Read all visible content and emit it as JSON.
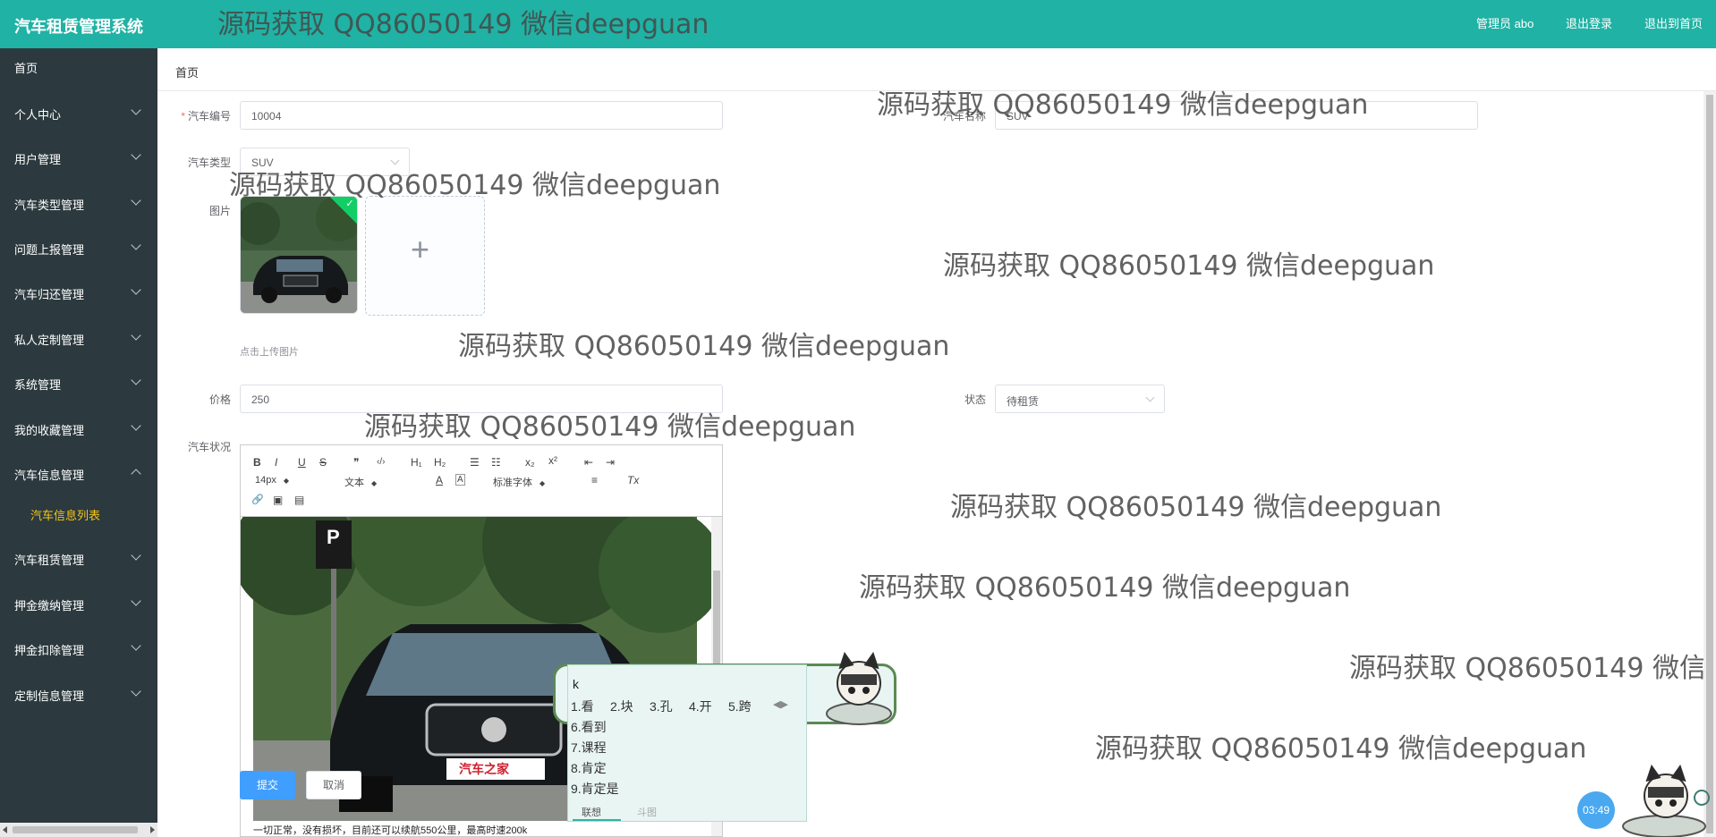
{
  "app": {
    "title": "汽车租赁管理系统"
  },
  "header": {
    "admin_label": "管理员 abo",
    "logout": "退出登录",
    "to_home": "退出到首页"
  },
  "sidebar": {
    "items": [
      {
        "label": "首页"
      },
      {
        "label": "个人中心"
      },
      {
        "label": "用户管理"
      },
      {
        "label": "汽车类型管理"
      },
      {
        "label": "问题上报管理"
      },
      {
        "label": "汽车归还管理"
      },
      {
        "label": "私人定制管理"
      },
      {
        "label": "系统管理"
      },
      {
        "label": "我的收藏管理"
      },
      {
        "label": "汽车信息管理"
      },
      {
        "label": "汽车租赁管理"
      },
      {
        "label": "押金缴纳管理"
      },
      {
        "label": "押金扣除管理"
      },
      {
        "label": "定制信息管理"
      }
    ],
    "sub_active": "汽车信息列表"
  },
  "breadcrumb": {
    "home": "首页"
  },
  "form": {
    "car_no": {
      "label": "汽车编号",
      "value": "10004"
    },
    "car_name": {
      "label": "汽车名称",
      "value": "SUV"
    },
    "car_type": {
      "label": "汽车类型",
      "value": "SUV"
    },
    "image": {
      "label": "图片",
      "tip": "点击上传图片",
      "success": "✓"
    },
    "price": {
      "label": "价格",
      "value": "250"
    },
    "status": {
      "label": "状态",
      "value": "待租赁"
    },
    "condition": {
      "label": "汽车状况",
      "text": "一切正常，没有损坏，目前还可以续航550公里，最高时速200k"
    }
  },
  "editor": {
    "font_size": "14px",
    "block": "文本",
    "font_family": "标准字体",
    "tools": {
      "bold": "B",
      "italic": "I",
      "underline": "U",
      "strike": "S",
      "quote": "❞",
      "code": "‹/›",
      "h1": "H₁",
      "h2": "H₂",
      "ol": "☰",
      "ul": "☷",
      "sub": "x₂",
      "sup": "x²",
      "outdent": "⇤",
      "indent": "⇥",
      "color": "A",
      "bg": "A",
      "align": "≡",
      "clear": "Tx",
      "link": "🔗",
      "image": "▣",
      "video": "▤"
    },
    "car_plate": "汽车之家"
  },
  "buttons": {
    "submit": "提交",
    "cancel": "取消"
  },
  "ime": {
    "input": "k",
    "candidates": [
      "1.看",
      "2.块",
      "3.孔",
      "4.开",
      "5.跨",
      "6.看到",
      "7.课程",
      "8.肯定",
      "9.肯定是"
    ],
    "tab_assoc": "联想",
    "tab_sticker": "斗图"
  },
  "watermark": "源码获取 QQ86050149 微信deepguan",
  "watermark_cut": "源码获取 QQ86050149 微信d",
  "timer": "03:49"
}
